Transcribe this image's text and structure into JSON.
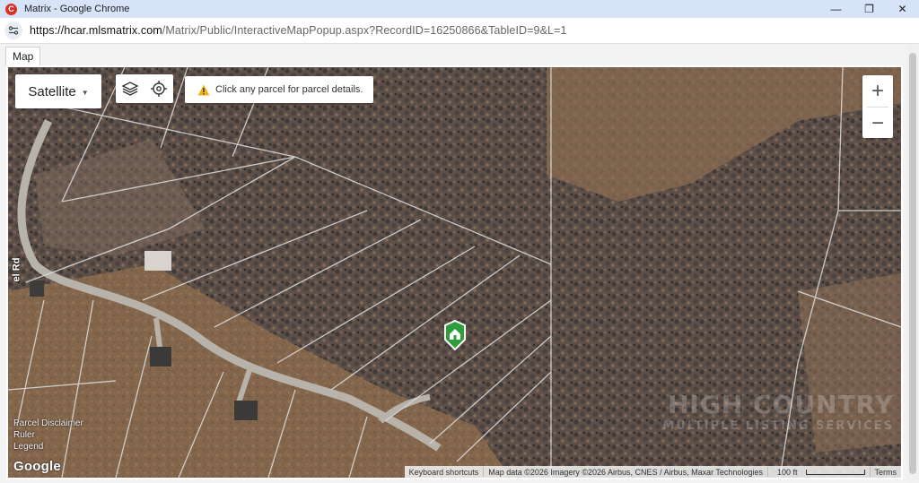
{
  "window": {
    "title": "Matrix - Google Chrome",
    "app_icon": "chrome-app-icon",
    "controls": {
      "minimize": "—",
      "restore": "❐",
      "close": "✕"
    }
  },
  "address_bar": {
    "url_host": "https://hcar.mlsmatrix.com",
    "url_path": "/Matrix/Public/InteractiveMapPopup.aspx?RecordID=16250866&TableID=9&L=1"
  },
  "tab": {
    "label": "Map"
  },
  "map": {
    "map_type": "Satellite",
    "toolbox": {
      "layers_icon": "layers-icon",
      "locate_icon": "crosshair-locate-icon"
    },
    "notice": "Click any parcel for parcel details.",
    "zoom_in": "+",
    "zoom_out": "−",
    "road_label": "el Rd",
    "left_links": [
      "Parcel Disclaimer",
      "Ruler",
      "Legend"
    ],
    "logo": "Google",
    "attribution": {
      "shortcuts": "Keyboard shortcuts",
      "map_data": "Map data ©2026 Imagery ©2026 Airbus, CNES / Airbus, Maxar Technologies",
      "scale": "100 ft",
      "terms": "Terms"
    },
    "watermark": [
      "HIGH COUNTRY",
      "MULTIPLE LISTING SERVICES"
    ],
    "marker_icon": "home-marker-icon",
    "colors": {
      "marker": "#2e9e3a",
      "warning": "#f2b01e"
    }
  }
}
